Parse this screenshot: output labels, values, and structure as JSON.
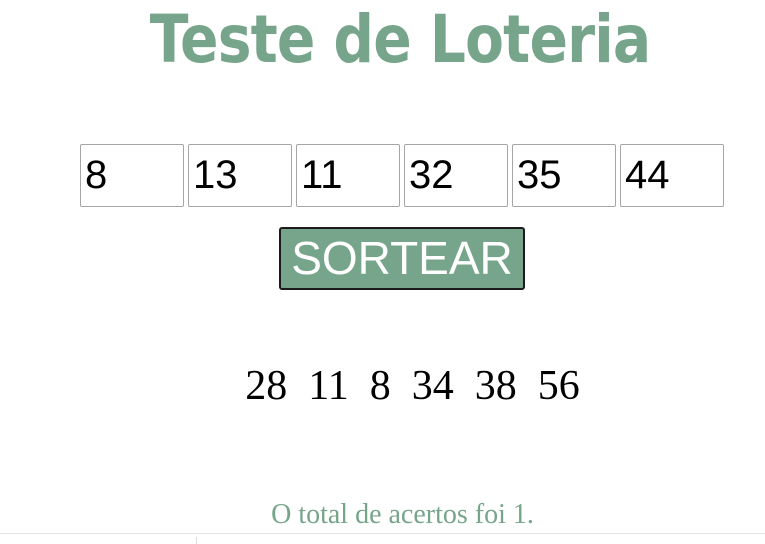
{
  "title": "Teste de Loteria",
  "inputs": {
    "n1": "8",
    "n2": "13",
    "n3": "11",
    "n4": "32",
    "n5": "35",
    "n6": "44"
  },
  "button": {
    "label": "SORTEAR"
  },
  "drawn_numbers": "28  11  8  34  38  56",
  "result_text": "O total de acertos foi 1.",
  "colors": {
    "accent": "#77a58b",
    "input_border": "#a6a6a6",
    "button_border": "#1b1b1b"
  }
}
